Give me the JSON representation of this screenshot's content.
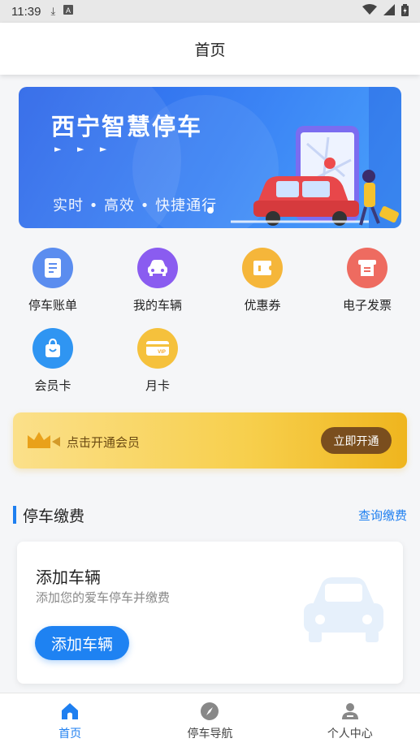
{
  "status_bar": {
    "time": "11:39",
    "icons": [
      "download-icon",
      "a-badge-icon",
      "wifi-icon",
      "signal-icon",
      "battery-icon"
    ]
  },
  "header": {
    "title": "首页"
  },
  "banner": {
    "title": "西宁智慧停车",
    "arrows": "► ► ►",
    "subtitle": "实时 • 高效 • 快捷通行"
  },
  "services": [
    {
      "label": "停车账单",
      "icon": "bill-icon",
      "color": "#5b8def"
    },
    {
      "label": "我的车辆",
      "icon": "car-icon",
      "color": "#8a5cf0"
    },
    {
      "label": "优惠券",
      "icon": "coupon-icon",
      "color": "#f5b63a"
    },
    {
      "label": "电子发票",
      "icon": "invoice-icon",
      "color": "#ee6b60"
    },
    {
      "label": "会员卡",
      "icon": "member-bag-icon",
      "color": "#2f95f2"
    },
    {
      "label": "月卡",
      "icon": "vip-card-icon",
      "color": "#f5c13c"
    }
  ],
  "vip_banner": {
    "text": "点击开通会员",
    "button": "立即开通"
  },
  "parking_section": {
    "title": "停车缴费",
    "link": "查询缴费"
  },
  "add_card": {
    "title": "添加车辆",
    "subtitle": "添加您的爱车停车并缴费",
    "button": "添加车辆"
  },
  "tabs": [
    {
      "label": "首页",
      "icon": "home-icon",
      "active": true
    },
    {
      "label": "停车导航",
      "icon": "compass-icon",
      "active": false
    },
    {
      "label": "个人中心",
      "icon": "user-icon",
      "active": false
    }
  ],
  "colors": {
    "accent": "#1e7ff0",
    "vip_button": "#7a4e1e"
  }
}
